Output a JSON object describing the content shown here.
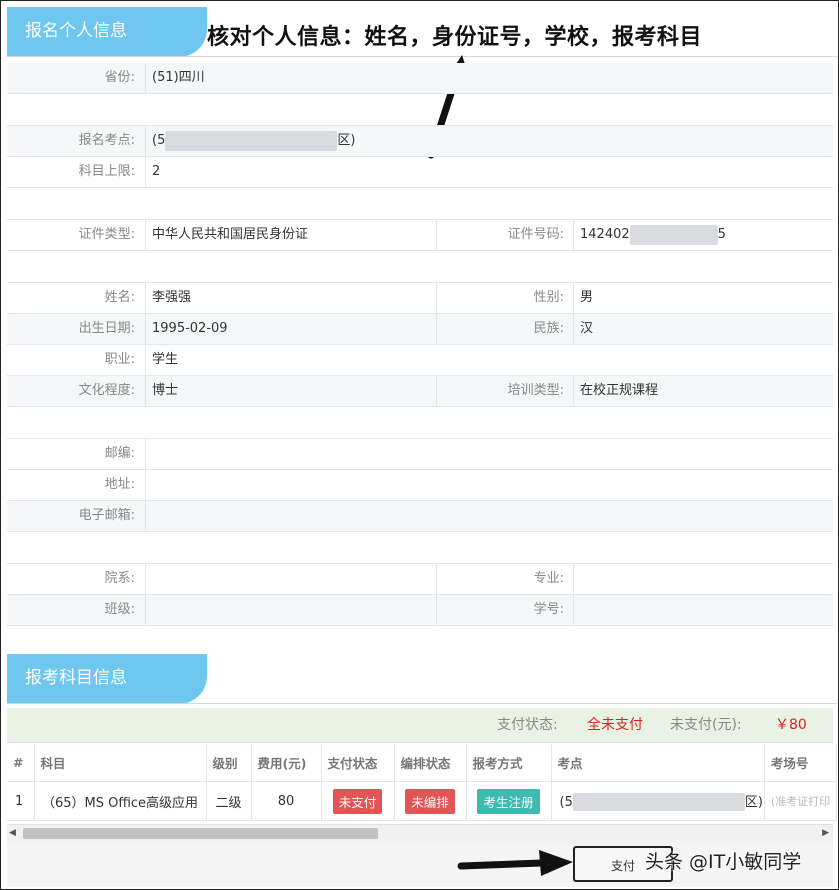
{
  "personal": {
    "header": "报名个人信息",
    "annotation": "核对个人信息：姓名，身份证号，学校，报考科目",
    "province_label": "省份:",
    "province_value": "(51)四川",
    "site_label": "报名考点:",
    "site_prefix": "(5",
    "site_suffix": "区)",
    "limit_label": "科目上限:",
    "limit_value": "2",
    "idtype_label": "证件类型:",
    "idtype_value": "中华人民共和国居民身份证",
    "idno_label": "证件号码:",
    "idno_prefix": "142402",
    "idno_suffix": "5",
    "name_label": "姓名:",
    "name_value": "李强强",
    "gender_label": "性别:",
    "gender_value": "男",
    "birth_label": "出生日期:",
    "birth_value": "1995-02-09",
    "ethnic_label": "民族:",
    "ethnic_value": "汉",
    "job_label": "职业:",
    "job_value": "学生",
    "edu_label": "文化程度:",
    "edu_value": "博士",
    "train_label": "培训类型:",
    "train_value": "在校正规课程",
    "zip_label": "邮编:",
    "addr_label": "地址:",
    "email_label": "电子邮箱:",
    "dept_label": "院系:",
    "major_label": "专业:",
    "class_label": "班级:",
    "stuno_label": "学号:"
  },
  "subjects": {
    "header": "报考科目信息",
    "pay_status_label": "支付状态:",
    "pay_status_value": "全未支付",
    "unpaid_label": "未支付(元):",
    "unpaid_value": "￥80",
    "columns": [
      "#",
      "科目",
      "级别",
      "费用(元)",
      "支付状态",
      "编排状态",
      "报考方式",
      "考点",
      "考场号"
    ],
    "rows": [
      {
        "index": "1",
        "subject": "（65）MS Office高级应用",
        "level": "二级",
        "fee": "80",
        "pay_status": "未支付",
        "arrange_status": "未编排",
        "method": "考生注册",
        "site_prefix": "(5",
        "site_suffix": "区)",
        "room": "(准考证打印"
      }
    ]
  },
  "footer": {
    "pay_button": "支付",
    "watermark": "头条 @IT小敏同学"
  },
  "colors": {
    "tab_blue": "#6fc6ee",
    "alert_red": "#e02020",
    "badge_red": "#e05555",
    "badge_teal": "#3dbbb0",
    "pay_row_green": "#e9f3e5"
  }
}
